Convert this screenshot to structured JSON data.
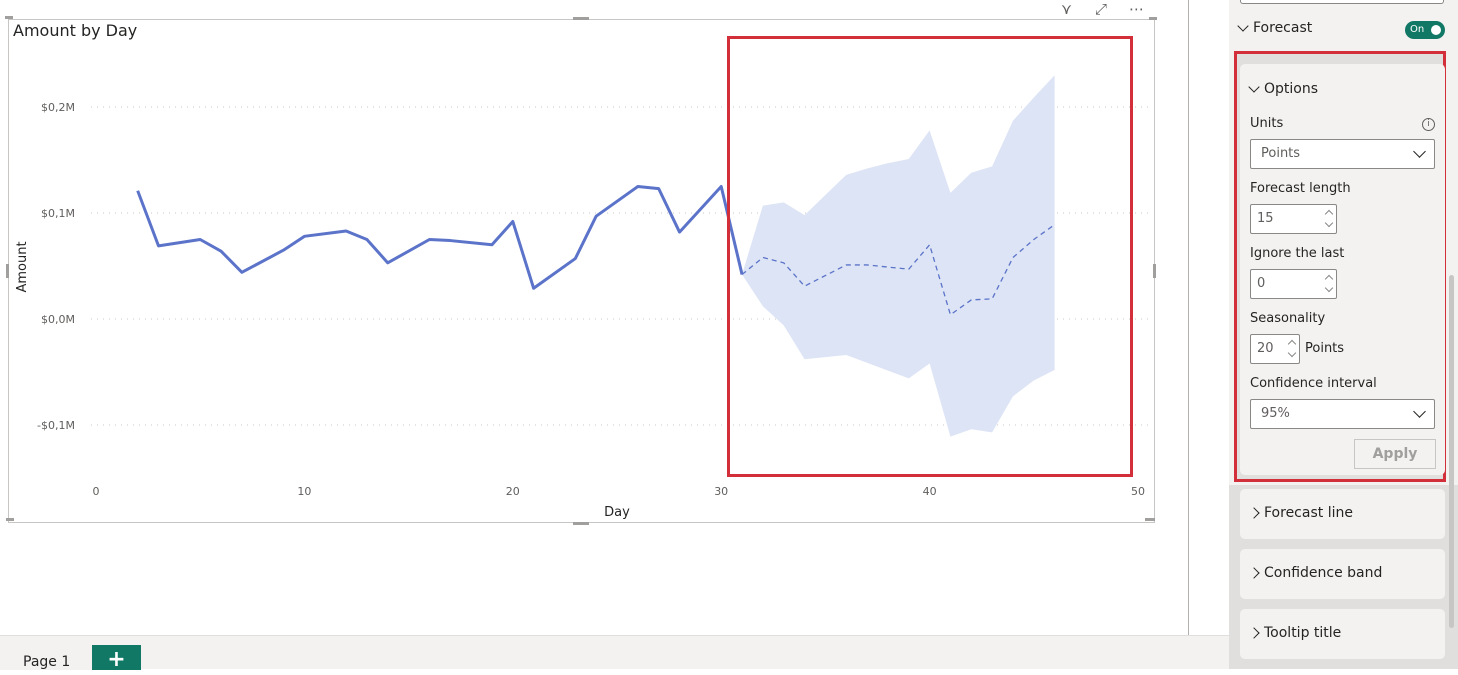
{
  "visual": {
    "title": "Amount by Day",
    "header_icons": [
      "filter-icon",
      "focus-mode-icon",
      "more-options-icon"
    ]
  },
  "chart_data": {
    "type": "line",
    "title": "Amount by Day",
    "xlabel": "Day",
    "ylabel": "Amount",
    "xlim": [
      0,
      50
    ],
    "ylim": [
      -0.15,
      0.25
    ],
    "x_ticks": [
      0,
      10,
      20,
      30,
      40,
      50
    ],
    "y_ticks": [
      {
        "value": 0.2,
        "label": "$0,2M"
      },
      {
        "value": 0.1,
        "label": "$0,1M"
      },
      {
        "value": 0.0,
        "label": "$0,0M"
      },
      {
        "value": -0.1,
        "label": "-$0,1M"
      }
    ],
    "y_units": "$M",
    "grid": true,
    "series": [
      {
        "name": "Amount",
        "style": "solid",
        "color": "#5b73c9",
        "x": [
          2,
          3,
          5,
          6,
          7,
          9,
          10,
          12,
          13,
          14,
          16,
          17,
          19,
          20,
          21,
          23,
          24,
          26,
          27,
          28,
          30,
          31
        ],
        "values": [
          0.121,
          0.069,
          0.075,
          0.064,
          0.044,
          0.065,
          0.078,
          0.083,
          0.075,
          0.053,
          0.075,
          0.074,
          0.07,
          0.092,
          0.029,
          0.057,
          0.097,
          0.125,
          0.123,
          0.082,
          0.125,
          0.042
        ]
      },
      {
        "name": "Forecast",
        "style": "dashed",
        "color": "#5b73c9",
        "x": [
          31,
          32,
          33,
          34,
          36,
          37,
          39,
          40,
          41,
          42,
          43,
          44,
          45,
          46
        ],
        "values": [
          0.042,
          0.058,
          0.053,
          0.031,
          0.051,
          0.051,
          0.047,
          0.07,
          0.004,
          0.018,
          0.019,
          0.058,
          0.075,
          0.089
        ]
      }
    ],
    "confidence_band": {
      "name": "Confidence band (95%)",
      "color": "#dde4f5",
      "upper": {
        "x": [
          31,
          32,
          33,
          34,
          36,
          37,
          38,
          39,
          40,
          41,
          42,
          43,
          44,
          45,
          46
        ],
        "values": [
          0.042,
          0.107,
          0.11,
          0.098,
          0.136,
          0.142,
          0.147,
          0.151,
          0.178,
          0.119,
          0.138,
          0.144,
          0.187,
          0.209,
          0.23
        ]
      },
      "lower": {
        "x": [
          31,
          32,
          33,
          34,
          36,
          39,
          40,
          41,
          42,
          43,
          44,
          45,
          46
        ],
        "values": [
          0.042,
          0.012,
          -0.006,
          -0.038,
          -0.034,
          -0.056,
          -0.042,
          -0.111,
          -0.104,
          -0.107,
          -0.073,
          -0.058,
          -0.048
        ]
      }
    },
    "highlight_color": "#d32f3a"
  },
  "pages": {
    "tabs": [
      {
        "label": "Page 1"
      }
    ],
    "add_label": "+"
  },
  "format_pane": {
    "forecast": {
      "label": "Forecast",
      "toggle_label": "On",
      "toggle_on": true,
      "accent": "#117865"
    },
    "options": {
      "label": "Options",
      "units_label": "Units",
      "units_value": "Points",
      "forecast_length_label": "Forecast length",
      "forecast_length_value": "15",
      "ignore_last_label": "Ignore the last",
      "ignore_last_value": "0",
      "seasonality_label": "Seasonality",
      "seasonality_value": "20",
      "seasonality_unit": "Points",
      "confidence_label": "Confidence interval",
      "confidence_value": "95%",
      "apply_label": "Apply"
    },
    "collapsed_sections": [
      {
        "label": "Forecast line"
      },
      {
        "label": "Confidence band"
      },
      {
        "label": "Tooltip title"
      }
    ]
  }
}
